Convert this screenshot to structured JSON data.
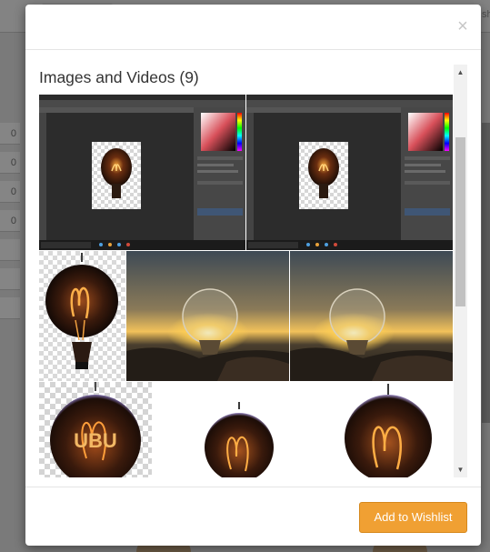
{
  "modal": {
    "close_label": "×",
    "section_title": "Images and Videos (9)",
    "wishlist_label": "Add to Wishlist"
  },
  "gallery": {
    "items": [
      {
        "kind": "software-screenshot",
        "subject": "filament light bulb on transparent background"
      },
      {
        "kind": "software-screenshot",
        "subject": "filament light bulb on transparent background"
      },
      {
        "kind": "photo",
        "subject": "glowing filament bulb on transparent background"
      },
      {
        "kind": "photo",
        "subject": "glass light bulb at sunset on rocks"
      },
      {
        "kind": "photo",
        "subject": "glass light bulb at sunset on rocks"
      },
      {
        "kind": "photo",
        "subject": "filament bulb with UBU lettering"
      },
      {
        "kind": "photo",
        "subject": "glowing filament bulb"
      },
      {
        "kind": "photo",
        "subject": "glowing filament bulb"
      }
    ],
    "embedded_text": "UBU"
  },
  "scrollbar": {
    "up_icon": "▲",
    "down_icon": "▼"
  },
  "background_page": {
    "sidebar_counts": [
      "0",
      "0",
      "0",
      "0"
    ]
  },
  "colors": {
    "accent": "#f0a033",
    "overlay": "#7a7a7a",
    "modal": "#ffffff"
  }
}
